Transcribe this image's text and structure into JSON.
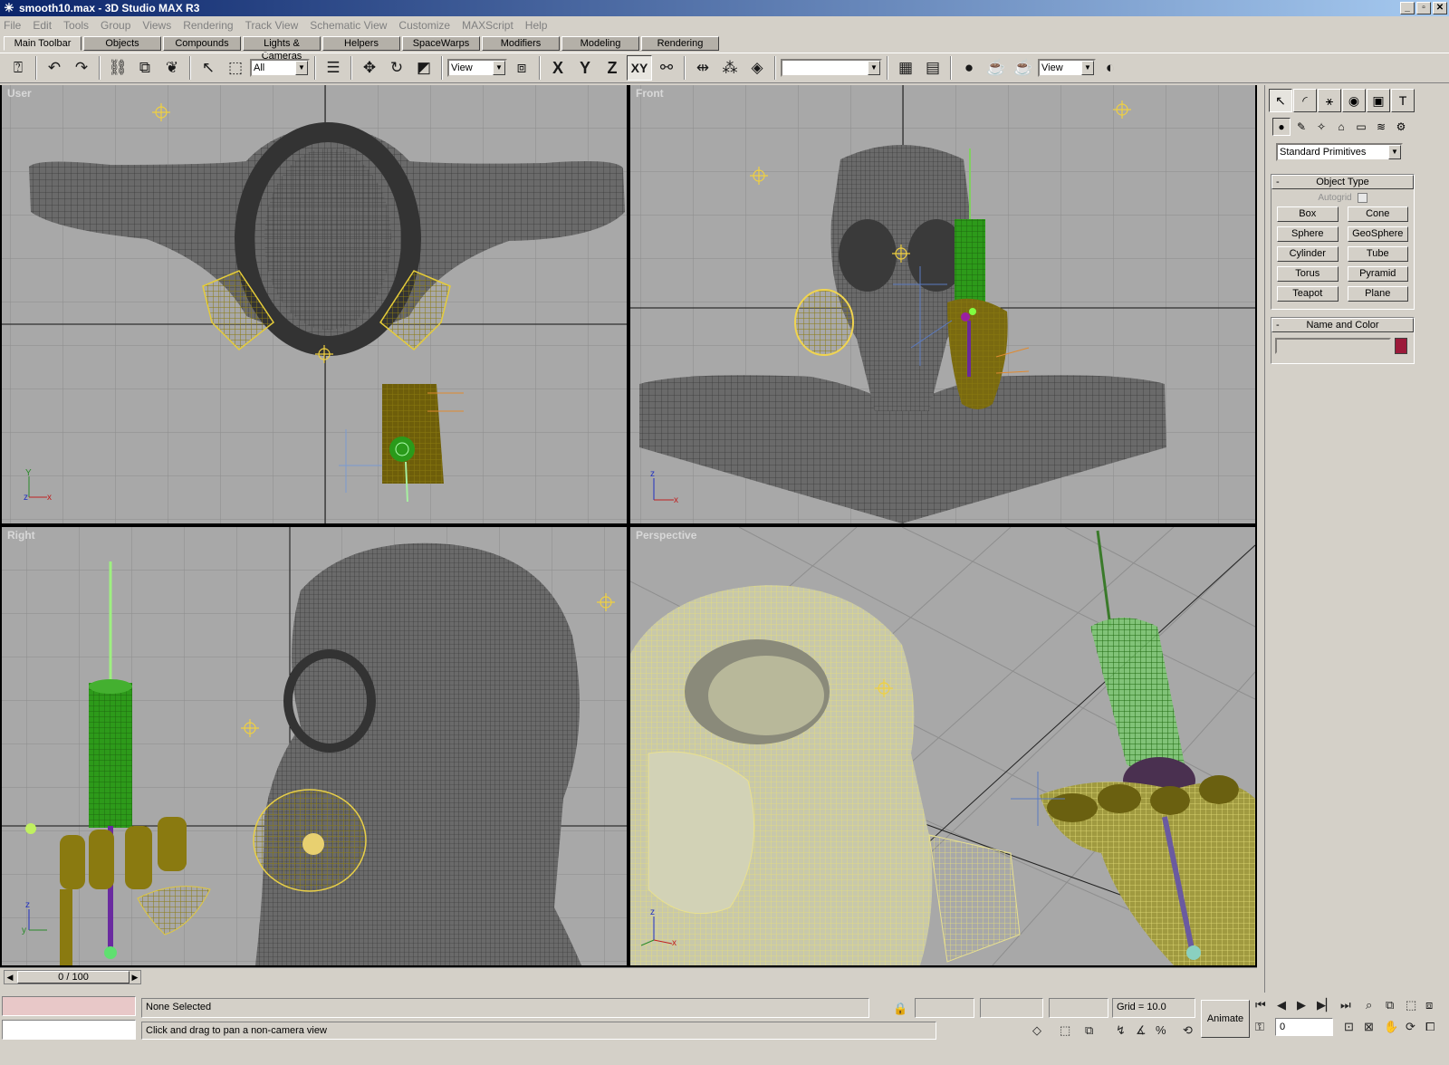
{
  "window": {
    "title": "smooth10.max - 3D Studio MAX R3",
    "min": "_",
    "max": "▫",
    "close": "✕"
  },
  "menu": [
    "File",
    "Edit",
    "Tools",
    "Group",
    "Views",
    "Rendering",
    "Track View",
    "Schematic View",
    "Customize",
    "MAXScript",
    "Help"
  ],
  "tabs": [
    "Main Toolbar",
    "Objects",
    "Compounds",
    "Lights & Cameras",
    "Helpers",
    "SpaceWarps",
    "Modifiers",
    "Modeling",
    "Rendering"
  ],
  "toolbar": {
    "selection_filter": "All",
    "ref_coord": "View",
    "named_selection": "",
    "render_view": "View",
    "axis_x": "X",
    "axis_y": "Y",
    "axis_z": "Z",
    "axis_xy": "XY"
  },
  "viewports": {
    "top_left": "User",
    "top_right": "Front",
    "bottom_left": "Right",
    "bottom_right": "Perspective"
  },
  "command_panel": {
    "category": "Standard Primitives",
    "object_type_title": "Object Type",
    "autogrid": "Autogrid",
    "buttons": [
      "Box",
      "Cone",
      "Sphere",
      "GeoSphere",
      "Cylinder",
      "Tube",
      "Torus",
      "Pyramid",
      "Teapot",
      "Plane"
    ],
    "name_color_title": "Name and Color",
    "object_name": "",
    "object_color": "#9c1a3a"
  },
  "timeline": {
    "frame": "0 / 100"
  },
  "status": {
    "selection": "None Selected",
    "prompt": "Click and drag to pan a non-camera view",
    "grid": "Grid = 10.0",
    "animate": "Animate",
    "current_frame": "0"
  },
  "colors": {
    "ui": "#d4d0c8",
    "viewport": "#a8a8a8",
    "mesh": "#4e4e4e",
    "selected_yellow": "#e8d24a",
    "green_helper": "#2f9a1a"
  }
}
